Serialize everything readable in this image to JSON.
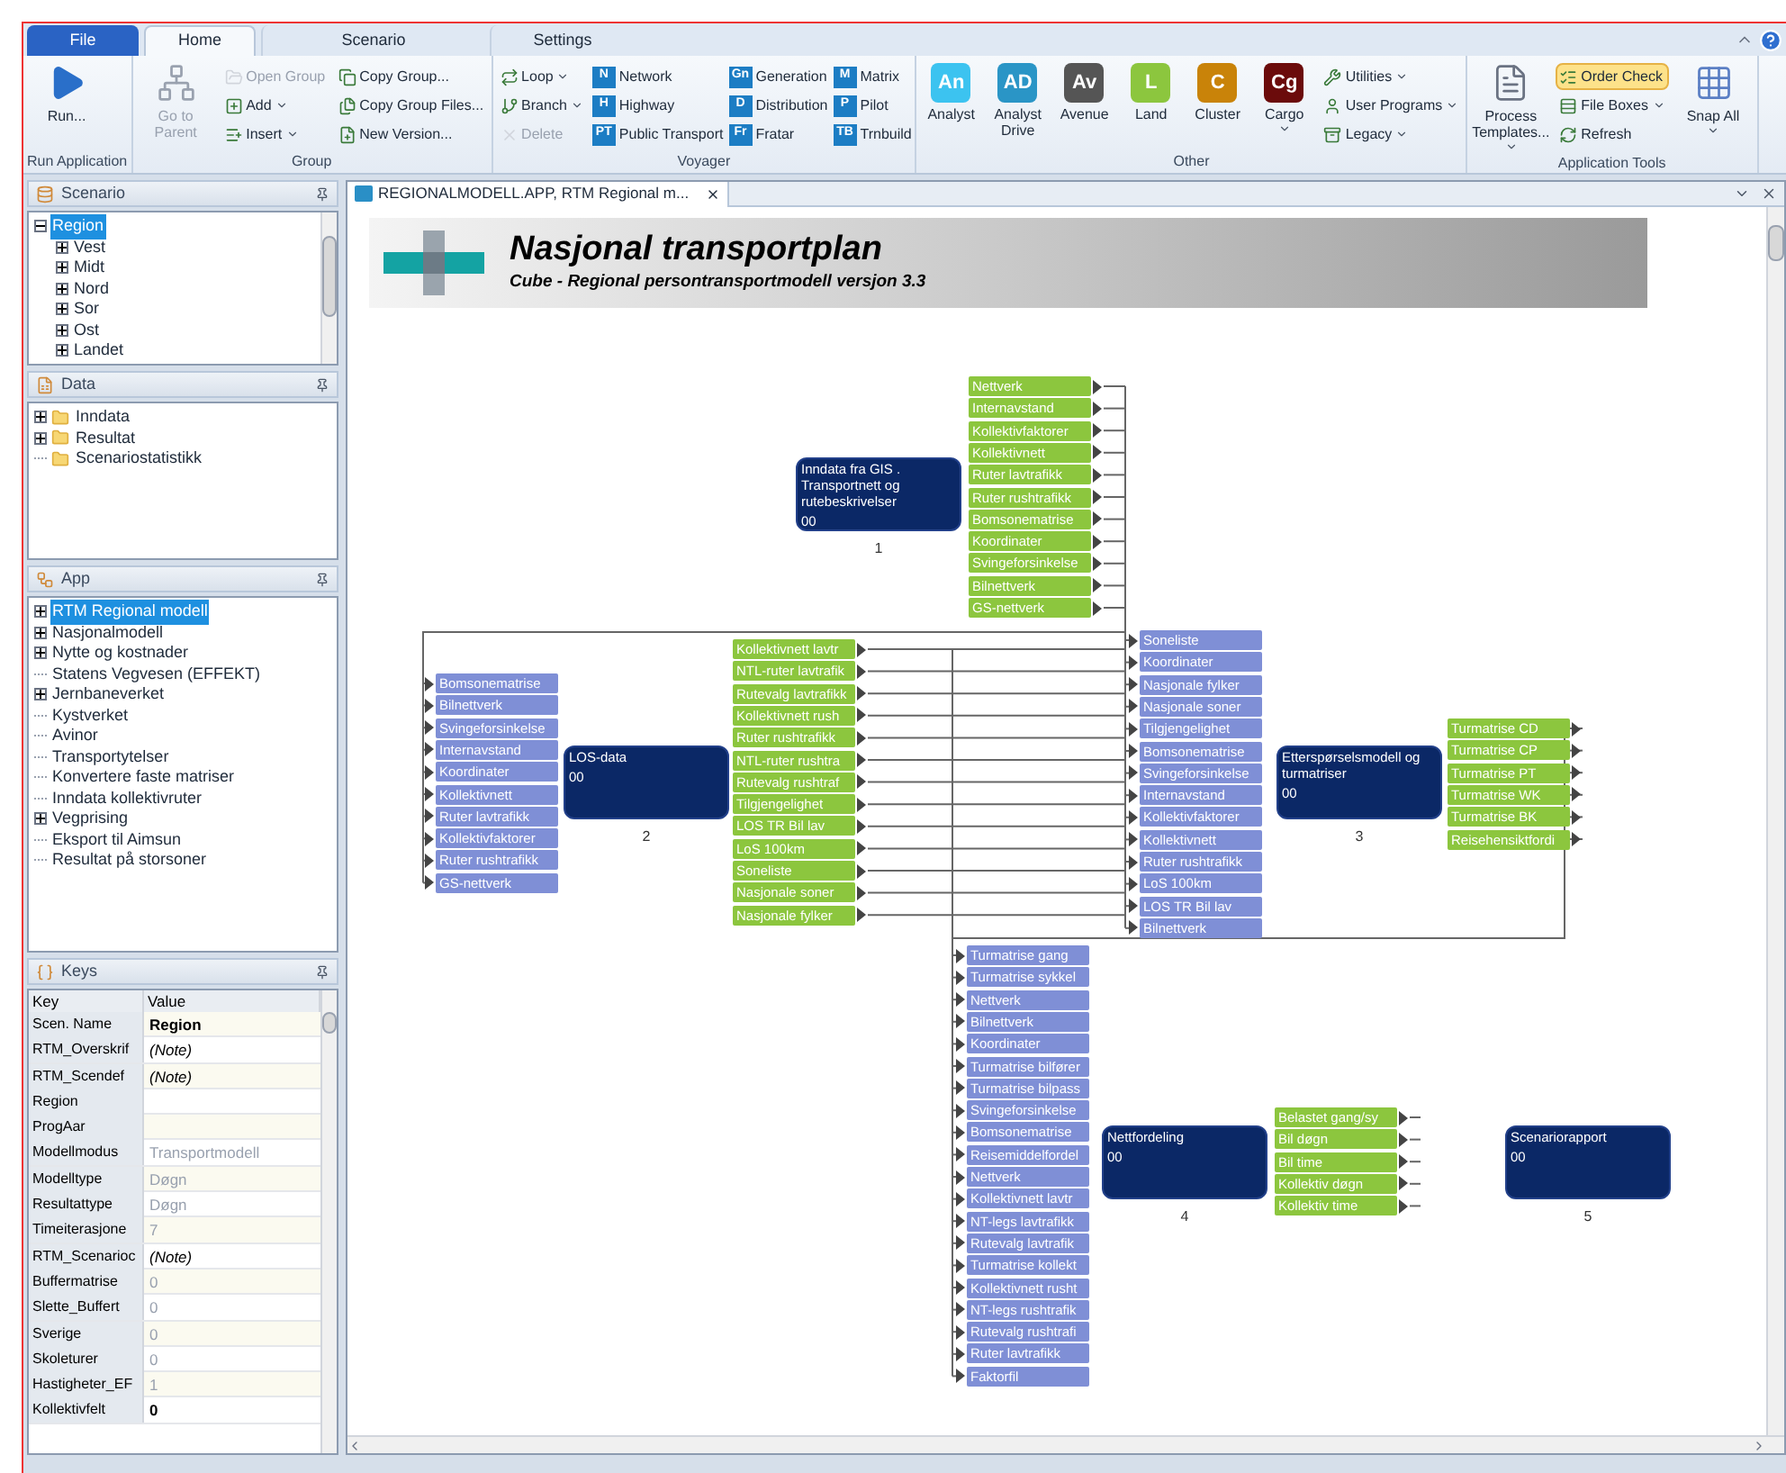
{
  "ribbon": {
    "tabs": [
      {
        "label": "File",
        "kind": "file",
        "selected": false
      },
      {
        "label": "Home",
        "kind": "tab",
        "selected": true
      },
      {
        "label": "Scenario",
        "kind": "tab",
        "selected": false
      },
      {
        "label": "Settings",
        "kind": "tab",
        "selected": false
      }
    ],
    "groups": [
      {
        "label": "Run Application",
        "columns": [
          [
            {
              "kind": "run",
              "label": "Run..."
            }
          ]
        ]
      },
      {
        "label": "Group",
        "columns": [
          [
            {
              "kind": "parent",
              "label": "Go to Parent",
              "disabled": true
            }
          ],
          [
            {
              "kind": "open",
              "label": "Open Group",
              "disabled": true
            },
            {
              "kind": "add",
              "label": "Add",
              "dropdown": true
            },
            {
              "kind": "insert",
              "label": "Insert",
              "dropdown": true
            }
          ],
          [
            {
              "kind": "copy",
              "label": "Copy Group..."
            },
            {
              "kind": "copyfiles",
              "label": "Copy Group Files..."
            },
            {
              "kind": "version",
              "label": "New Version..."
            }
          ]
        ]
      },
      {
        "label": "Voyager",
        "columns": [
          [
            {
              "kind": "loop",
              "label": "Loop",
              "dropdown": true
            },
            {
              "kind": "branch",
              "label": "Branch",
              "dropdown": true
            },
            {
              "kind": "delete",
              "label": "Delete",
              "disabled": true
            }
          ],
          [
            {
              "kind": "module",
              "badge": "N",
              "label": "Network"
            },
            {
              "kind": "module",
              "badge": "H",
              "label": "Highway"
            },
            {
              "kind": "module",
              "badge": "PT",
              "label": "Public Transport"
            }
          ],
          [
            {
              "kind": "module",
              "badge": "Gn",
              "label": "Generation"
            },
            {
              "kind": "module",
              "badge": "D",
              "label": "Distribution"
            },
            {
              "kind": "module",
              "badge": "Fr",
              "label": "Fratar"
            }
          ],
          [
            {
              "kind": "module",
              "badge": "M",
              "label": "Matrix"
            },
            {
              "kind": "module",
              "badge": "P",
              "label": "Pilot"
            },
            {
              "kind": "module",
              "badge": "TB",
              "label": "Trnbuild"
            }
          ]
        ]
      },
      {
        "label": "Other",
        "columns": [
          [
            {
              "kind": "app",
              "badge": "An",
              "label": "Analyst",
              "color": "#3cc3f0"
            }
          ],
          [
            {
              "kind": "app",
              "badge": "AD",
              "label": "Analyst Drive",
              "color": "#2a95c6"
            }
          ],
          [
            {
              "kind": "app",
              "badge": "Av",
              "label": "Avenue",
              "color": "#555555"
            }
          ],
          [
            {
              "kind": "app",
              "badge": "L",
              "label": "Land",
              "color": "#8cc63e"
            }
          ],
          [
            {
              "kind": "app",
              "badge": "C",
              "label": "Cluster",
              "color": "#c98309"
            }
          ],
          [
            {
              "kind": "app",
              "badge": "Cg",
              "label": "Cargo",
              "color": "#6b0b0b",
              "dropdown": true
            }
          ],
          [
            {
              "kind": "utilities",
              "label": "Utilities",
              "dropdown": true
            },
            {
              "kind": "programs",
              "label": "User Programs",
              "dropdown": true
            },
            {
              "kind": "legacy",
              "label": "Legacy",
              "dropdown": true
            }
          ]
        ]
      },
      {
        "label": "Application Tools",
        "columns": [
          [
            {
              "kind": "templates",
              "label": "Process Templates...",
              "dropdown": true
            }
          ],
          [
            {
              "kind": "order",
              "label": "Order Check",
              "checked": true
            },
            {
              "kind": "fileboxes",
              "label": "File Boxes",
              "dropdown": true
            },
            {
              "kind": "refresh",
              "label": "Refresh"
            }
          ],
          [
            {
              "kind": "snap",
              "label": "Snap All",
              "dropdown": true
            }
          ]
        ]
      }
    ]
  },
  "panels": [
    {
      "title": "Scenario",
      "kind": "scenario",
      "tree": [
        {
          "label": "Region",
          "selected": true,
          "expanded": true,
          "children": [
            {
              "label": "Vest",
              "selected": false,
              "expanded": false
            },
            {
              "label": "Midt",
              "selected": false,
              "expanded": false
            },
            {
              "label": "Nord",
              "selected": false,
              "expanded": false
            },
            {
              "label": "Sor",
              "selected": false,
              "expanded": false
            },
            {
              "label": "Ost",
              "selected": false,
              "expanded": false
            },
            {
              "label": "Landet",
              "selected": false,
              "expanded": false
            }
          ]
        }
      ]
    },
    {
      "title": "Data",
      "kind": "data",
      "tree": [
        {
          "label": "Inndata",
          "kind": "folder",
          "selected": false,
          "expanded": false
        },
        {
          "label": "Resultat",
          "kind": "folder",
          "selected": false,
          "expanded": false
        },
        {
          "label": "Scenariostatistikk",
          "kind": "folder",
          "selected": false
        }
      ]
    },
    {
      "title": "App",
      "kind": "app",
      "tree": [
        {
          "label": "RTM Regional modell",
          "selected": true,
          "expanded": false
        },
        {
          "label": "Nasjonalmodell",
          "selected": false,
          "expanded": false
        },
        {
          "label": "Nytte og kostnader",
          "selected": false,
          "expanded": false
        },
        {
          "label": "Statens Vegvesen (EFFEKT)",
          "selected": false
        },
        {
          "label": "Jernbaneverket",
          "selected": false,
          "expanded": false
        },
        {
          "label": "Kystverket",
          "selected": false
        },
        {
          "label": "Avinor",
          "selected": false
        },
        {
          "label": "Transportytelser",
          "selected": false
        },
        {
          "label": "Konvertere faste matriser",
          "selected": false
        },
        {
          "label": "Inndata kollektivruter",
          "selected": false
        },
        {
          "label": "Vegprising",
          "selected": false,
          "expanded": false
        },
        {
          "label": "Eksport til Aimsun",
          "selected": false
        },
        {
          "label": "Resultat på storsoner",
          "selected": false
        }
      ]
    }
  ],
  "keys": {
    "title": "Keys",
    "columns": [
      "Key",
      "Value"
    ],
    "rows": [
      {
        "key": "Scen. Name",
        "value": "Region",
        "kind": "bold"
      },
      {
        "key": "RTM_Overskrif",
        "value": "(Note)",
        "kind": "note"
      },
      {
        "key": "RTM_Scendef",
        "value": "(Note)",
        "kind": "note"
      },
      {
        "key": "Region"
      },
      {
        "key": "ProgAar"
      },
      {
        "key": "Modellmodus",
        "value": "Transportmodell",
        "kind": "readonly"
      },
      {
        "key": "Modelltype",
        "value": "Døgn",
        "kind": "readonly"
      },
      {
        "key": "Resultattype",
        "value": "Døgn",
        "kind": "readonly"
      },
      {
        "key": "Timeiterasjone",
        "value": "7",
        "kind": "readonly"
      },
      {
        "key": "RTM_Scenarioc",
        "value": "(Note)",
        "kind": "note"
      },
      {
        "key": "Buffermatrise",
        "value": "0",
        "kind": "readonly"
      },
      {
        "key": "Slette_Buffert",
        "value": "0",
        "kind": "readonly"
      },
      {
        "key": "Sverige",
        "value": "0",
        "kind": "readonly"
      },
      {
        "key": "Skoleturer",
        "value": "0",
        "kind": "readonly"
      },
      {
        "key": "Hastigheter_EF",
        "value": "1",
        "kind": "readonly"
      },
      {
        "key": "Kollektivfelt",
        "value": "0",
        "kind": "bold"
      }
    ]
  },
  "document": {
    "tab": "REGIONALMODELL.APP, RTM Regional m...",
    "banner": {
      "title": "Nasjonal transportplan",
      "subtitle": "Cube - Regional persontransportmodell versjon 3.3"
    },
    "nodes": [
      {
        "title": "Inndata fra GIS . Transportnett og rutebeskrivelser",
        "code": "00",
        "number": "1",
        "outputs": [
          "Nettverk",
          "Internavstand",
          "Kollektivfaktorer",
          "Kollektivnett",
          "Ruter lavtrafikk",
          "Ruter rushtrafikk",
          "Bomsonematrise",
          "Koordinater",
          "Svingeforsinkelse",
          "Bilnettverk",
          "GS-nettverk"
        ]
      },
      {
        "title": "LOS-data",
        "code": "00",
        "number": "2",
        "inputs": [
          "Bomsonematrise",
          "Bilnettverk",
          "Svingeforsinkelse",
          "Internavstand",
          "Koordinater",
          "Kollektivnett",
          "Ruter lavtrafikk",
          "Kollektivfaktorer",
          "Ruter rushtrafikk",
          "GS-nettverk"
        ],
        "outputs": [
          "Kollektivnett lavtr",
          "NTL-ruter lavtrafik",
          "Rutevalg lavtrafikk",
          "Kollektivnett rush",
          "Ruter rushtrafikk",
          "NTL-ruter rushtra",
          "Rutevalg rushtraf",
          "Tilgjengelighet",
          "LOS TR Bil lav",
          "LoS 100km",
          "Soneliste",
          "Nasjonale soner",
          "Nasjonale fylker"
        ]
      },
      {
        "title": "Etterspørselsmodell og turmatriser",
        "code": "00",
        "number": "3",
        "inputs": [
          "Soneliste",
          "Koordinater",
          "Nasjonale fylker",
          "Nasjonale soner",
          "Tilgjengelighet",
          "Bomsonematrise",
          "Svingeforsinkelse",
          "Internavstand",
          "Kollektivfaktorer",
          "Kollektivnett",
          "Ruter rushtrafikk",
          "LoS 100km",
          "LOS TR Bil lav",
          "Bilnettverk"
        ],
        "outputs": [
          "Turmatrise CD",
          "Turmatrise CP",
          "Turmatrise PT",
          "Turmatrise WK",
          "Turmatrise BK",
          "Reisehensiktfordi"
        ]
      },
      {
        "title": "Nettfordeling",
        "code": "00",
        "number": "4",
        "inputs": [
          "Turmatrise gang",
          "Turmatrise sykkel",
          "Nettverk",
          "Bilnettverk",
          "Koordinater",
          "Turmatrise bilfører",
          "Turmatrise bilpass",
          "Svingeforsinkelse",
          "Bomsonematrise",
          "Reisemiddelfordel",
          "Nettverk",
          "Kollektivnett lavtr",
          "NT-legs lavtrafikk",
          "Rutevalg lavtrafik",
          "Turmatrise kollekt",
          "Kollektivnett rusht",
          "NT-legs rushtrafik",
          "Rutevalg rushtrafi",
          "Ruter lavtrafikk",
          "Faktorfil"
        ],
        "outputs": [
          "Belastet gang/sy",
          "Bil døgn",
          "Bil time",
          "Kollektiv døgn",
          "Kollektiv time"
        ]
      },
      {
        "title": "Scenariorapport",
        "code": "00",
        "number": "5"
      }
    ]
  }
}
